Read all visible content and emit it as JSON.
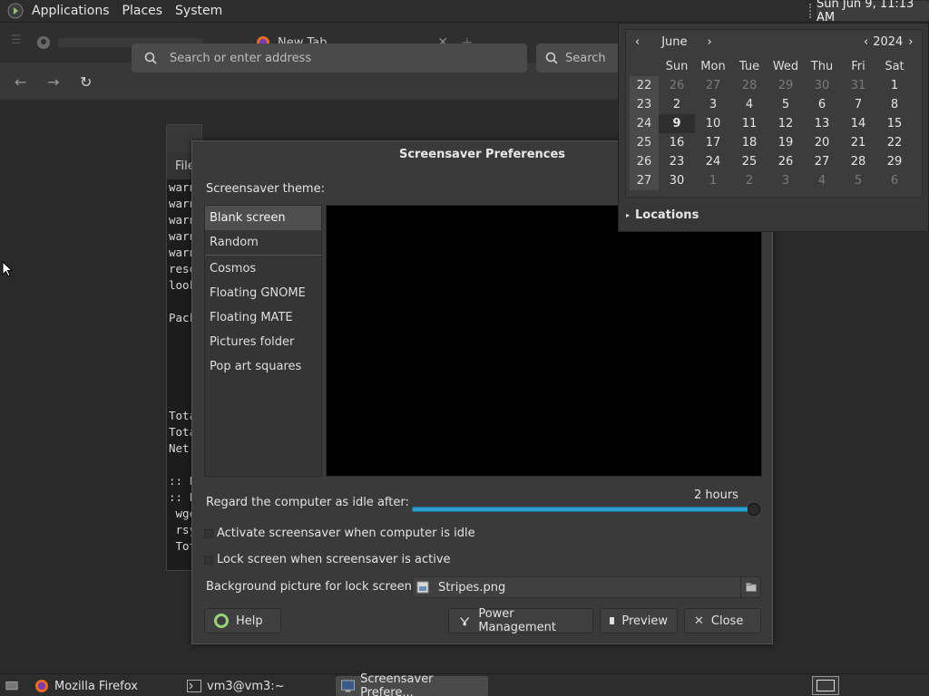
{
  "top_panel": {
    "menus": [
      "Applications",
      "Places",
      "System"
    ],
    "clock": "Sun Jun  9, 11:13 AM"
  },
  "firefox": {
    "tab1_label": "New Tab",
    "url_placeholder": "Search or enter address",
    "search_placeholder": "Search"
  },
  "terminal": {
    "menu_label": "File",
    "lines": [
      "warn",
      "warn",
      "warn",
      "warn",
      "warn",
      "reso",
      "look",
      "",
      "Pack",
      "",
      "",
      "",
      "",
      "",
      "Tota",
      "Tota",
      "Net",
      "",
      ":: P",
      ":: P",
      " wge",
      " rsy",
      " Tot"
    ]
  },
  "dialog": {
    "title": "Screensaver Preferences",
    "theme_label": "Screensaver theme:",
    "themes_top": [
      "Blank screen",
      "Random"
    ],
    "themes_bottom": [
      "Cosmos",
      "Floating GNOME",
      "Floating MATE",
      "Pictures folder",
      "Pop art squares"
    ],
    "selected_theme": "Blank screen",
    "idle_label": "Regard the computer as idle after:",
    "idle_value": "2 hours",
    "idle_fraction": 1.0,
    "activate_label": "Activate screensaver when computer is idle",
    "lock_label": "Lock screen when screensaver is active",
    "bg_label": "Background picture for lock screen:",
    "bg_file": "Stripes.png",
    "buttons": {
      "help": "Help",
      "power": "Power Management",
      "preview": "Preview",
      "close": "Close"
    }
  },
  "calendar": {
    "month": "June",
    "year": "2024",
    "weekdays": [
      "Sun",
      "Mon",
      "Tue",
      "Wed",
      "Thu",
      "Fri",
      "Sat"
    ],
    "weeks": [
      {
        "wk": "22",
        "days": [
          "26",
          "27",
          "28",
          "29",
          "30",
          "31",
          "1"
        ],
        "dim": [
          true,
          true,
          true,
          true,
          true,
          true,
          false
        ]
      },
      {
        "wk": "23",
        "days": [
          "2",
          "3",
          "4",
          "5",
          "6",
          "7",
          "8"
        ],
        "dim": [
          false,
          false,
          false,
          false,
          false,
          false,
          false
        ]
      },
      {
        "wk": "24",
        "days": [
          "9",
          "10",
          "11",
          "12",
          "13",
          "14",
          "15"
        ],
        "dim": [
          false,
          false,
          false,
          false,
          false,
          false,
          false
        ]
      },
      {
        "wk": "25",
        "days": [
          "16",
          "17",
          "18",
          "19",
          "20",
          "21",
          "22"
        ],
        "dim": [
          false,
          false,
          false,
          false,
          false,
          false,
          false
        ]
      },
      {
        "wk": "26",
        "days": [
          "23",
          "24",
          "25",
          "26",
          "27",
          "28",
          "29"
        ],
        "dim": [
          false,
          false,
          false,
          false,
          false,
          false,
          false
        ]
      },
      {
        "wk": "27",
        "days": [
          "30",
          "1",
          "2",
          "3",
          "4",
          "5",
          "6"
        ],
        "dim": [
          false,
          true,
          true,
          true,
          true,
          true,
          true
        ]
      }
    ],
    "today": "9",
    "locations_label": "Locations"
  },
  "taskbar": {
    "items": [
      "Mozilla Firefox",
      "vm3@vm3:~",
      "Screensaver Prefere..."
    ]
  },
  "colors": {
    "slider_fill": "#2c9fd1",
    "panel_bg": "#2d2d2d"
  }
}
